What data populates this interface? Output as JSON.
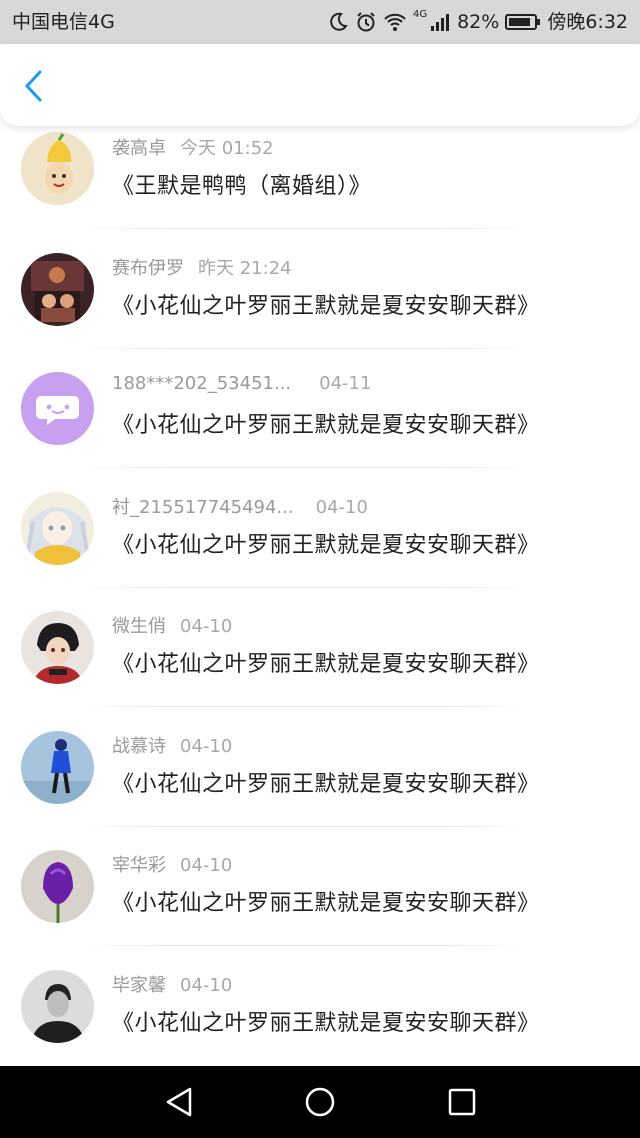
{
  "status_bar": {
    "carrier": "中国电信4G",
    "network_badge": "4G",
    "battery_percent": "82%",
    "time": "傍晚6:32",
    "icons": [
      "moon-icon",
      "alarm-icon",
      "wifi-icon",
      "signal-icon",
      "battery-icon"
    ]
  },
  "header": {
    "back_icon": "chevron-left-icon",
    "accent": "#1a9bf0"
  },
  "items": [
    {
      "name": "袭高卓",
      "time": "今天 01:52",
      "title": "《王默是鸭鸭（离婚组）》",
      "avatar": "cartoon-avatar"
    },
    {
      "name": "赛布伊罗",
      "time": "昨天 21:24",
      "title": "《小花仙之叶罗丽王默就是夏安安聊天群》",
      "avatar": "dark-scene-avatar"
    },
    {
      "name": "188***202_53451...",
      "time": "04-11",
      "title": "《小花仙之叶罗丽王默就是夏安安聊天群》",
      "avatar": "default-chat-avatar"
    },
    {
      "name": "衬_215517745494...",
      "time": "04-10",
      "title": "《小花仙之叶罗丽王默就是夏安安聊天群》",
      "avatar": "anime-girl-avatar"
    },
    {
      "name": "微生俏",
      "time": "04-10",
      "title": "《小花仙之叶罗丽王默就是夏安安聊天群》",
      "avatar": "anime-boy-avatar"
    },
    {
      "name": "战慕诗",
      "time": "04-10",
      "title": "《小花仙之叶罗丽王默就是夏安安聊天群》",
      "avatar": "blue-figure-avatar"
    },
    {
      "name": "宰华彩",
      "time": "04-10",
      "title": "《小花仙之叶罗丽王默就是夏安安聊天群》",
      "avatar": "purple-flower-avatar"
    },
    {
      "name": "毕家馨",
      "time": "04-10",
      "title": "《小花仙之叶罗丽王默就是夏安安聊天群》",
      "avatar": "bw-portrait-avatar"
    }
  ],
  "nav_bar": {
    "buttons": [
      "back-triangle-icon",
      "home-circle-icon",
      "recents-square-icon"
    ]
  }
}
